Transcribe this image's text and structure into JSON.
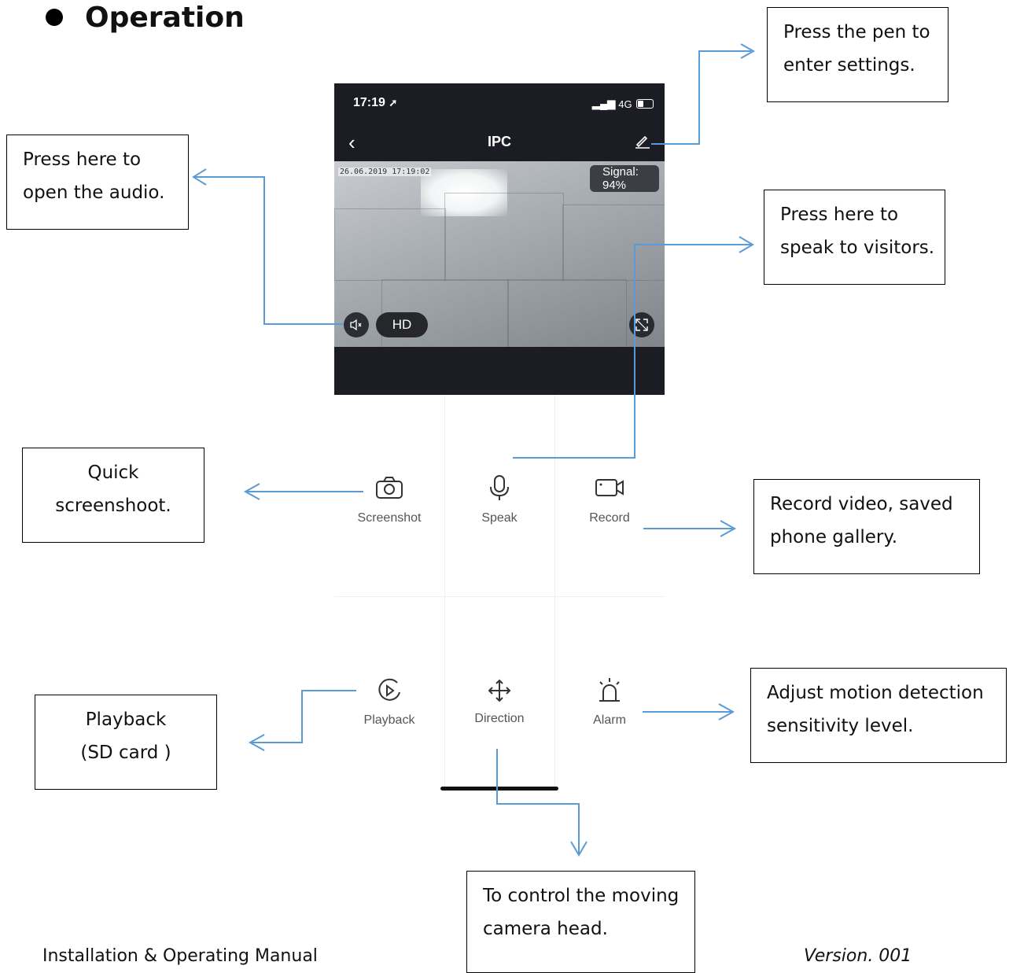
{
  "heading": {
    "title": "Operation"
  },
  "phone": {
    "status_time": "17:19",
    "status_network": "4G",
    "screen_title": "IPC",
    "timestamp": "26.06.2019 17:19:02",
    "signal_label": "Signal:",
    "signal_value": "94%",
    "hd_label": "HD"
  },
  "controls": {
    "screenshot": "Screenshot",
    "speak": "Speak",
    "record": "Record",
    "playback": "Playback",
    "direction": "Direction",
    "alarm": "Alarm"
  },
  "callouts": {
    "pen": [
      "Press the pen to",
      "enter settings."
    ],
    "audio": [
      "Press here to",
      "open the audio."
    ],
    "speak": [
      "Press here to",
      "speak to visitors."
    ],
    "screenshot": [
      "Quick",
      "screenshoot."
    ],
    "record": [
      "Record video, saved",
      "phone gallery."
    ],
    "playback": [
      "Playback",
      "(SD card )"
    ],
    "alarm": [
      "Adjust motion detection",
      "sensitivity level."
    ],
    "direction": [
      "To control the moving",
      "camera head."
    ]
  },
  "footer": {
    "left": "Installation & Operating Manual",
    "right": "Version. 001"
  },
  "colors": {
    "arrow": "#5b9bd5",
    "phone_bg": "#1c1d24"
  }
}
